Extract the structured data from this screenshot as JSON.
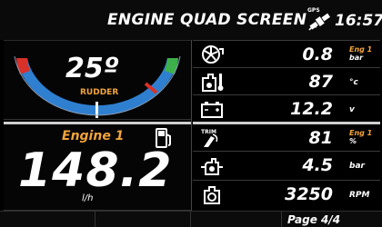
{
  "header": {
    "title": "ENGINE QUAD SCREEN",
    "gps_label": "GPS",
    "time": "16:57"
  },
  "rudder": {
    "value": "25º",
    "label": "RUDDER",
    "colors": {
      "arc": "#2f7fd0",
      "right": "#3db04b",
      "left": "#d8312a"
    }
  },
  "engine": {
    "name": "Engine 1",
    "fuel_flow": "148.2",
    "fuel_flow_unit": "l/h"
  },
  "rows": [
    {
      "icon": "turbo-icon",
      "value": "0.8",
      "unit_top": "Eng 1",
      "unit": "bar"
    },
    {
      "icon": "oil-temp-icon",
      "value": "87",
      "unit": "°c"
    },
    {
      "icon": "battery-icon",
      "value": "12.2",
      "unit": "v"
    },
    {
      "icon": "trim-icon",
      "icon_label": "TRIM",
      "value": "81",
      "unit_top": "Eng 1",
      "unit": "%"
    },
    {
      "icon": "oil-pressure-icon",
      "value": "4.5",
      "unit": "bar"
    },
    {
      "icon": "engine-rpm-icon",
      "value": "3250",
      "unit": "RPM"
    }
  ],
  "footer": {
    "page": "Page 4/4"
  }
}
